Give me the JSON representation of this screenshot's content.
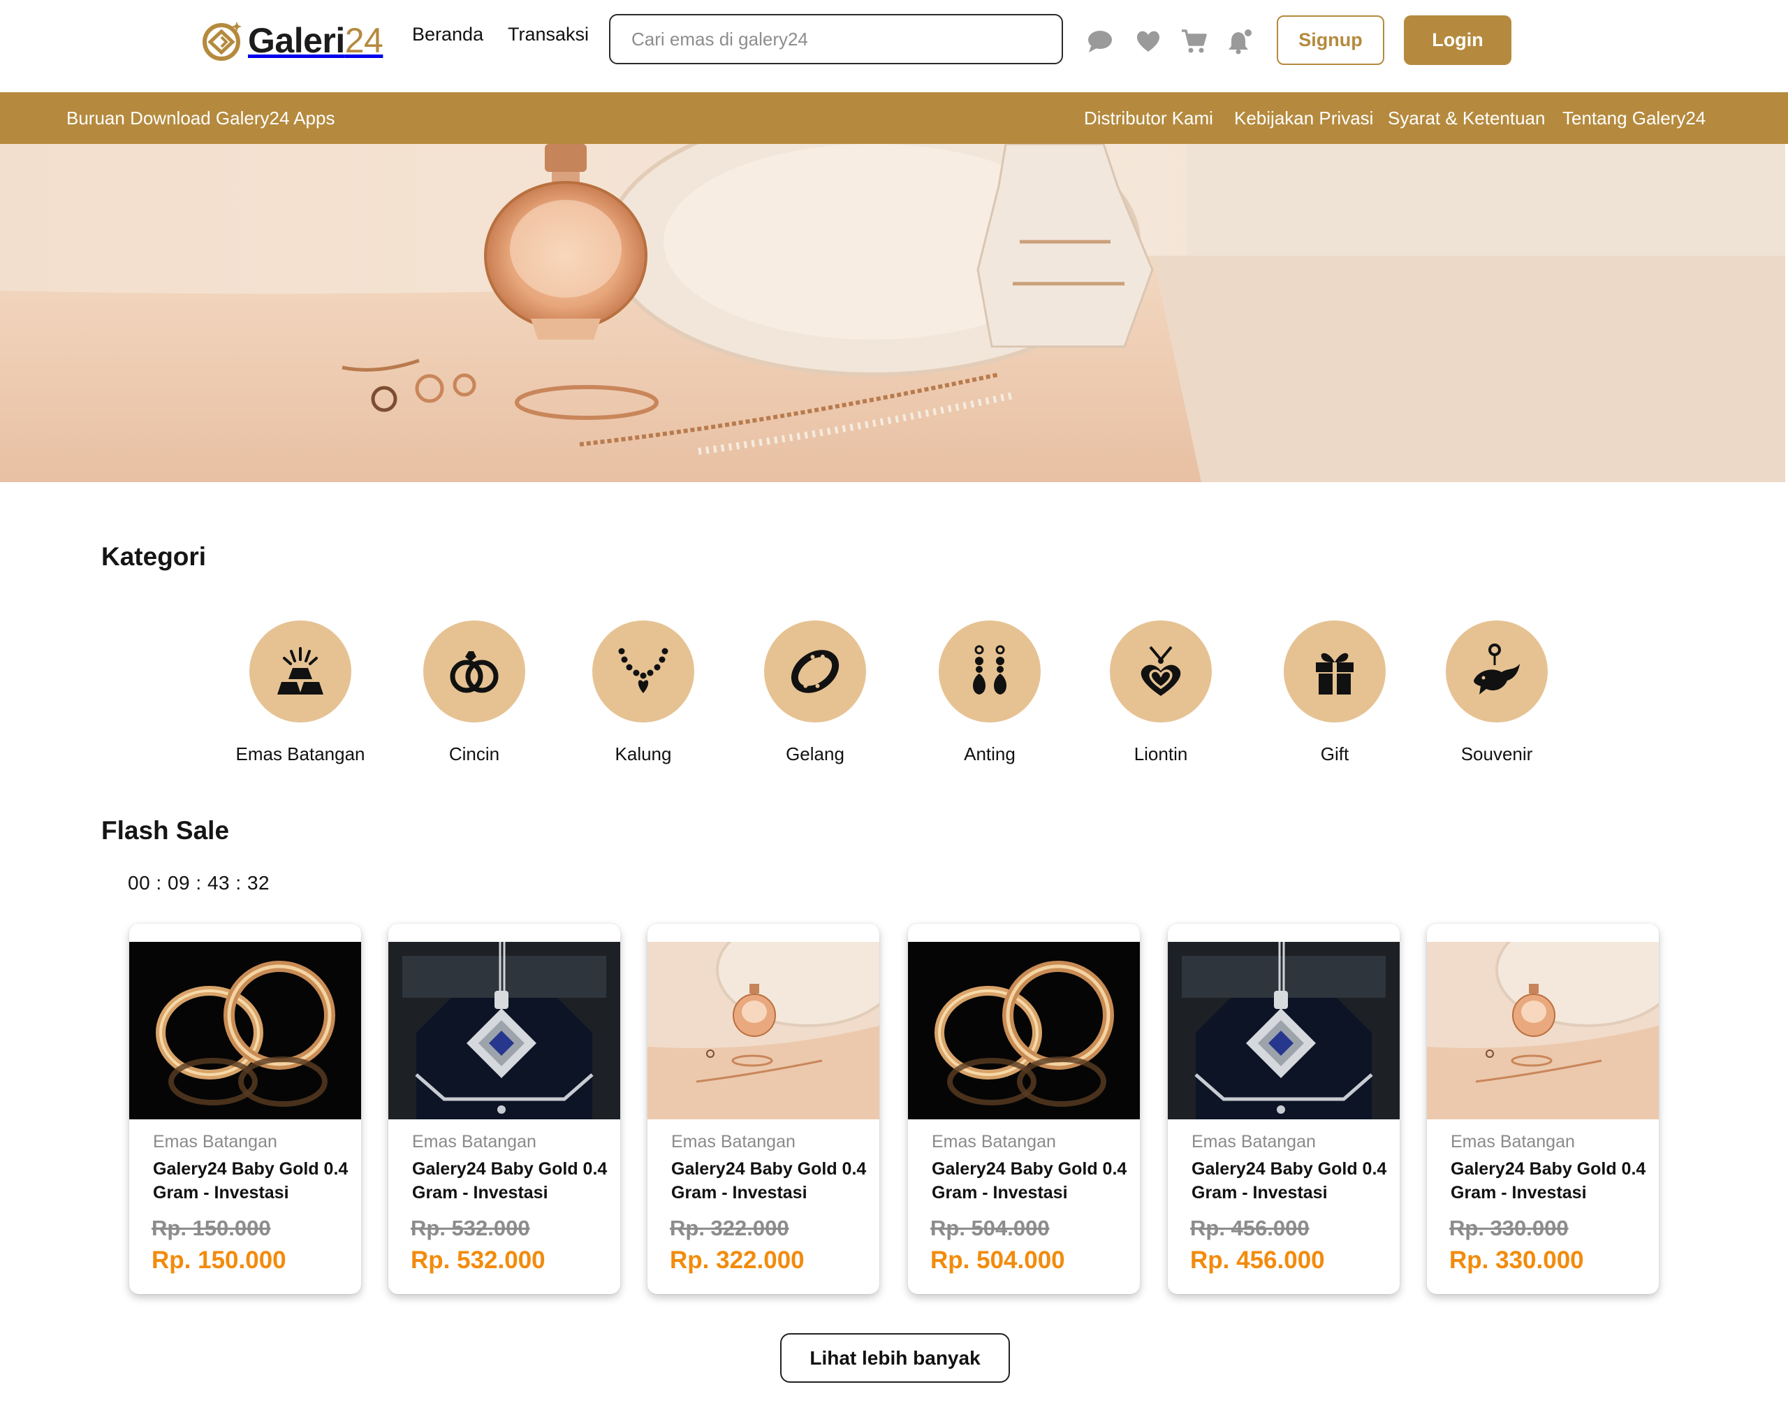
{
  "brand": {
    "name_part1": "Galeri",
    "name_part2": "24",
    "gold": "#b58a3e",
    "cat_bg": "#e6c293",
    "price_color": "#f28b0c"
  },
  "nav": {
    "home": "Beranda",
    "transactions": "Transaksi"
  },
  "search": {
    "placeholder": "Cari emas di galery24"
  },
  "header_icons": [
    "chat-icon",
    "heart-icon",
    "cart-icon",
    "bell-icon"
  ],
  "auth": {
    "signup": "Signup",
    "login": "Login"
  },
  "topbar": {
    "promo": "Buruan Download Galery24 Apps",
    "links": [
      "Distributor Kami",
      "Kebijakan Privasi",
      "Syarat & Ketentuan",
      "Tentang Galery24"
    ]
  },
  "categories": {
    "title": "Kategori",
    "items": [
      {
        "label": "Emas Batangan",
        "icon": "gold-bars-icon"
      },
      {
        "label": "Cincin",
        "icon": "rings-icon"
      },
      {
        "label": "Kalung",
        "icon": "necklace-icon"
      },
      {
        "label": "Gelang",
        "icon": "bracelet-icon"
      },
      {
        "label": "Anting",
        "icon": "earrings-icon"
      },
      {
        "label": "Liontin",
        "icon": "heart-pendant-icon"
      },
      {
        "label": "Gift",
        "icon": "gift-icon"
      },
      {
        "label": "Souvenir",
        "icon": "dolphin-keychain-icon"
      }
    ]
  },
  "flash_sale": {
    "title": "Flash Sale",
    "timer": "00 : 09  : 43 : 32",
    "products": [
      {
        "category": "Emas Batangan",
        "name": "Galery24 Baby Gold 0.4 Gram - Investasi",
        "old_price": "Rp. 150.000",
        "price": "Rp. 150.000",
        "image": "gold-hoop-earrings"
      },
      {
        "category": "Emas Batangan",
        "name": "Galery24 Baby Gold 0.4 Gram - Investasi",
        "old_price": "Rp. 532.000",
        "price": "Rp. 532.000",
        "image": "sapphire-pendant"
      },
      {
        "category": "Emas Batangan",
        "name": "Galery24 Baby Gold 0.4 Gram - Investasi",
        "old_price": "Rp. 322.000",
        "price": "Rp. 322.000",
        "image": "perfume-jewelry"
      },
      {
        "category": "Emas Batangan",
        "name": "Galery24 Baby Gold 0.4 Gram - Investasi",
        "old_price": "Rp. 504.000",
        "price": "Rp. 504.000",
        "image": "gold-hoop-earrings"
      },
      {
        "category": "Emas Batangan",
        "name": "Galery24 Baby Gold 0.4 Gram - Investasi",
        "old_price": "Rp. 456.000",
        "price": "Rp. 456.000",
        "image": "sapphire-pendant"
      },
      {
        "category": "Emas Batangan",
        "name": "Galery24 Baby Gold 0.4 Gram - Investasi",
        "old_price": "Rp. 330.000",
        "price": "Rp. 330.000",
        "image": "perfume-jewelry"
      }
    ],
    "more_button": "Lihat lebih  banyak"
  }
}
